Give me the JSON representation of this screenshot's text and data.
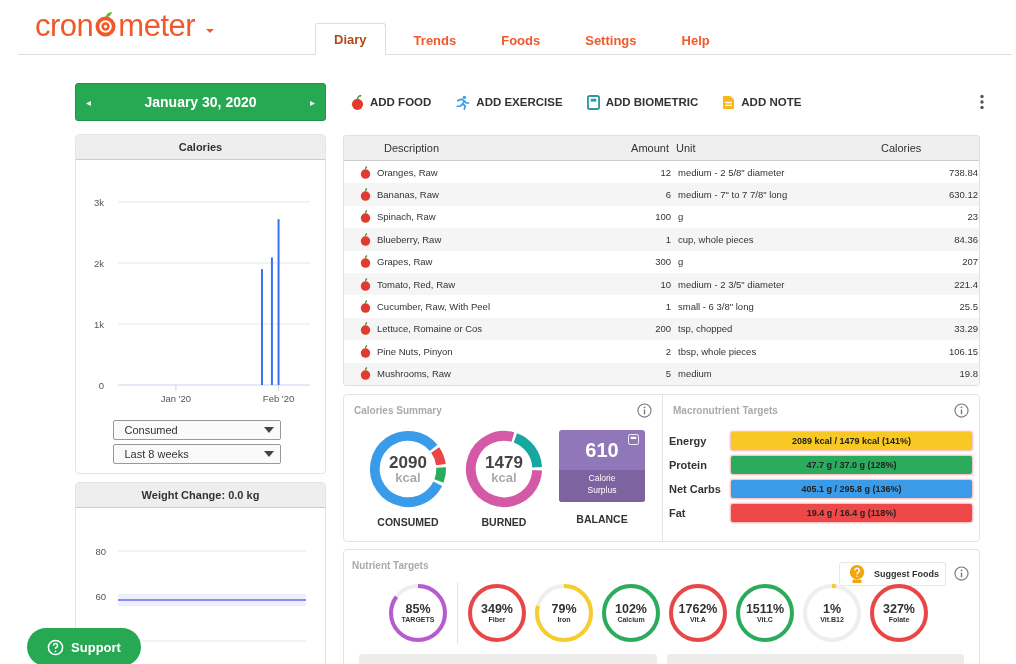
{
  "logo": {
    "before": "cron",
    "after": "meter"
  },
  "tabs": [
    {
      "label": "Diary",
      "selected": true
    },
    {
      "label": "Trends",
      "selected": false
    },
    {
      "label": "Foods",
      "selected": false
    },
    {
      "label": "Settings",
      "selected": false
    },
    {
      "label": "Help",
      "selected": false
    }
  ],
  "date_picker": {
    "prev": "◂",
    "label": "January 30, 2020",
    "next": "▸"
  },
  "actions": [
    {
      "kind": "food",
      "label": "ADD FOOD"
    },
    {
      "kind": "exercise",
      "label": "ADD EXERCISE"
    },
    {
      "kind": "biometric",
      "label": "ADD BIOMETRIC"
    },
    {
      "kind": "note",
      "label": "ADD NOTE"
    }
  ],
  "calories_panel": {
    "title": "Calories",
    "chart_data": {
      "type": "bar",
      "categories": [
        null,
        null,
        null,
        null,
        null,
        null,
        null,
        null,
        null,
        null,
        null,
        null,
        null,
        null,
        null,
        null,
        null,
        "Jan '20",
        null,
        null,
        null,
        null,
        null,
        null,
        null,
        null,
        null,
        null,
        null,
        null,
        null,
        null,
        null,
        null,
        null,
        null,
        null,
        null,
        null,
        null,
        null,
        null,
        null,
        null,
        null,
        null,
        null,
        null,
        "Feb '20",
        null,
        null,
        null,
        null,
        null,
        null,
        null,
        null,
        null
      ],
      "values": [
        null,
        null,
        null,
        null,
        null,
        null,
        null,
        null,
        null,
        null,
        null,
        null,
        null,
        null,
        null,
        null,
        null,
        null,
        null,
        null,
        null,
        null,
        null,
        null,
        null,
        null,
        null,
        null,
        null,
        null,
        null,
        null,
        null,
        null,
        null,
        null,
        null,
        null,
        null,
        null,
        null,
        null,
        null,
        1900,
        null,
        null,
        2090,
        null,
        2720,
        null,
        null,
        null,
        null,
        null,
        null,
        null,
        null,
        null
      ],
      "ylim": [
        0,
        3000
      ],
      "yticks": [
        {
          "value": 0,
          "label": "0"
        },
        {
          "value": 1000,
          "label": "1k"
        },
        {
          "value": 2000,
          "label": "2k"
        },
        {
          "value": 3000,
          "label": "3k"
        }
      ]
    },
    "selects": [
      "Consumed",
      "Last 8 weeks"
    ]
  },
  "weight_panel": {
    "title": "Weight Change: 0.0 kg",
    "axis_labels": [
      "80",
      "60"
    ]
  },
  "table": {
    "columns": [
      "Description",
      "Amount",
      "Unit",
      "Calories"
    ],
    "rows": [
      [
        "Oranges, Raw",
        "12",
        "medium - 2 5/8\" diameter",
        "738.84"
      ],
      [
        "Bananas, Raw",
        "6",
        "medium - 7\" to 7 7/8\" long",
        "630.12"
      ],
      [
        "Spinach, Raw",
        "100",
        "g",
        "23"
      ],
      [
        "Blueberry, Raw",
        "1",
        "cup, whole pieces",
        "84.36"
      ],
      [
        "Grapes, Raw",
        "300",
        "g",
        "207"
      ],
      [
        "Tomato, Red, Raw",
        "10",
        "medium - 2 3/5\" diameter",
        "221.4"
      ],
      [
        "Cucumber, Raw, With Peel",
        "1",
        "small - 6 3/8\" long",
        "25.5"
      ],
      [
        "Lettuce, Romaine or Cos",
        "200",
        "tsp, chopped",
        "33.29"
      ],
      [
        "Pine Nuts, Pinyon",
        "2",
        "tbsp, whole pieces",
        "106.15"
      ],
      [
        "Mushrooms, Raw",
        "5",
        "medium",
        "19.8"
      ]
    ]
  },
  "calories_summary": {
    "title": "Calories Summary",
    "rings": [
      {
        "value": "2090",
        "unit": "kcal",
        "label": "CONSUMED",
        "segments": [
          {
            "color": "#e94747",
            "level": 0.09
          },
          {
            "color": "#2bac5c",
            "level": 0.08
          },
          {
            "color": "#3a9be8",
            "level": 0.83
          }
        ]
      },
      {
        "value": "1479",
        "unit": "kcal",
        "label": "BURNED",
        "segments": [
          {
            "color": "#16a8a0",
            "level": 0.2
          },
          {
            "color": "#d45aa8",
            "level": 0.8
          }
        ]
      }
    ],
    "balance": {
      "value": "610",
      "caption": "Calorie Surplus",
      "label": "BALANCE"
    }
  },
  "macro_targets": {
    "title": "Macronutrient Targets",
    "rows": [
      {
        "name": "Energy",
        "text": "2089 kcal / 1479 kcal (141%)",
        "color": "#f8c924"
      },
      {
        "name": "Protein",
        "text": "47.7 g / 37.0 g (128%)",
        "color": "#2bac5c"
      },
      {
        "name": "Net Carbs",
        "text": "405.1 g / 295.8 g (136%)",
        "color": "#3a9be8"
      },
      {
        "name": "Fat",
        "text": "19.4 g / 16.4 g (118%)",
        "color": "#ee4848"
      }
    ]
  },
  "nutrient_targets": {
    "title": "Nutrient Targets",
    "suggest_button": "Suggest Foods",
    "rings": [
      {
        "value": "85%",
        "label": "TARGETS",
        "color": "#b65bd0"
      },
      {
        "value": "349%",
        "label": "Fiber",
        "color": "#e94747"
      },
      {
        "value": "79%",
        "label": "Iron",
        "color": "#f6cd2a"
      },
      {
        "value": "102%",
        "label": "Calcium",
        "color": "#2bac5c"
      },
      {
        "value": "1762%",
        "label": "Vit.A",
        "color": "#e94747"
      },
      {
        "value": "1511%",
        "label": "Vit.C",
        "color": "#2bac5c"
      },
      {
        "value": "1%",
        "label": "Vit.B12",
        "color": "#f6cd2a"
      },
      {
        "value": "327%",
        "label": "Folate",
        "color": "#e94747"
      }
    ]
  },
  "support_button": "Support"
}
